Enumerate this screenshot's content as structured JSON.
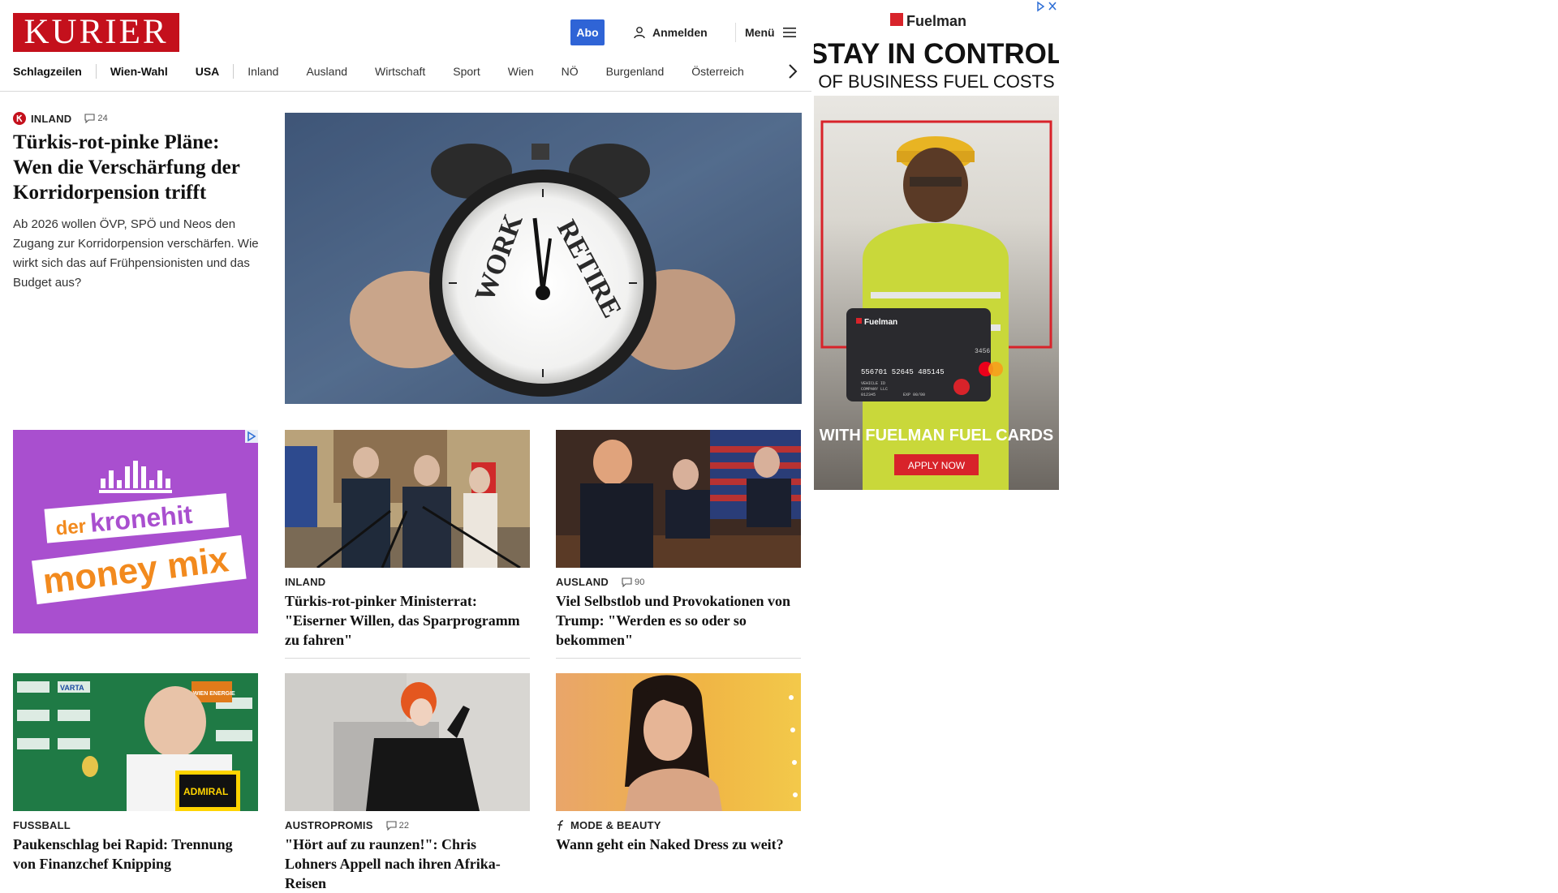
{
  "header": {
    "logo": "KURIER",
    "abo_label": "Abo",
    "login_label": "Anmelden",
    "menu_label": "Menü"
  },
  "nav": {
    "items": [
      "Schlagzeilen",
      "Wien-Wahl",
      "USA",
      "Inland",
      "Ausland",
      "Wirtschaft",
      "Sport",
      "Wien",
      "NÖ",
      "Burgenland",
      "Österreich"
    ]
  },
  "lead": {
    "category": "INLAND",
    "comments": "24",
    "headline": "Türkis-rot-pinke Pläne: Wen die Verschärfung der Korridorpension trifft",
    "teaser": "Ab 2026 wollen ÖVP, SPÖ und Neos den Zugang zur Korridorpension verschärfen. Wie wirkt sich das auf Frühpensionisten und das Budget aus?",
    "image_text_left": "WORK",
    "image_text_right": "RETIRE"
  },
  "promo": {
    "line1_a": "der",
    "line1_b": "kronehit",
    "line2": "money mix"
  },
  "articles": [
    {
      "category": "INLAND",
      "comments": "",
      "headline": "Türkis-rot-pinker Ministerrat: \"Eiserner Willen, das Sparprogramm zu fahren\""
    },
    {
      "category": "AUSLAND",
      "comments": "90",
      "headline": "Viel Selbstlob und Provokationen von Trump: \"Werden es so oder so bekommen\""
    },
    {
      "category": "FUSSBALL",
      "comments": "",
      "headline": "Paukenschlag bei Rapid: Trennung von Finanzchef Knipping"
    },
    {
      "category": "AUSTROPROMIS",
      "comments": "22",
      "headline": "\"Hört auf zu raunzen!\": Chris Lohners Appell nach ihren Afrika-Reisen"
    },
    {
      "category": "MODE & BEAUTY",
      "comments": "",
      "headline": "Wann geht ein Naked Dress zu weit?"
    }
  ],
  "photo_text": {
    "sponsor_admiral": "ADMIRAL",
    "sponsor_varta": "VARTA",
    "sponsor_wien_energie": "WIEN ENERGIE"
  },
  "ad": {
    "brand": "Fuelman",
    "headline": "STAY IN CONTROL",
    "subheadline": "OF BUSINESS FUEL COSTS",
    "tagline": "WITH FUELMAN FUEL CARDS",
    "cta": "APPLY NOW",
    "card_brand": "Fuelman",
    "card_number": "556701 52645 485145",
    "card_last": "3456",
    "card_line1": "VEHICLE ID",
    "card_line2": "COMPANY LLC",
    "card_line3": "012345",
    "card_exp": "EXP 00/00"
  },
  "colors": {
    "brand_red": "#c4101c",
    "abo_blue": "#2f64d6",
    "promo_purple": "#a94fcf",
    "ad_red": "#d8232a"
  }
}
